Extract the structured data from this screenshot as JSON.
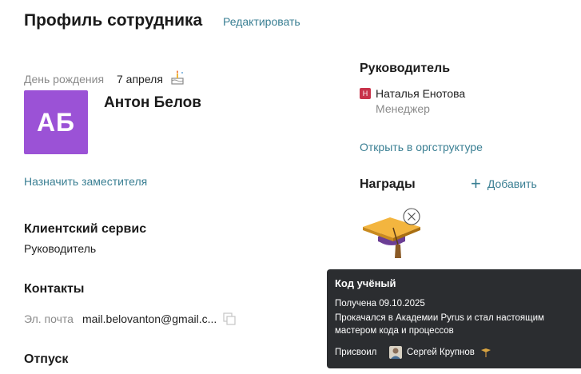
{
  "header": {
    "title": "Профиль сотрудника",
    "edit_label": "Редактировать"
  },
  "profile": {
    "birthday_label": "День рождения",
    "birthday_value": "7 апреля",
    "avatar_initials": "АБ",
    "avatar_color": "#9b52d6",
    "name": "Антон Белов",
    "assign_deputy": "Назначить заместителя",
    "department": "Клиентский сервис",
    "department_role": "Руководитель",
    "contacts_title": "Контакты",
    "email_label": "Эл. почта",
    "email_value": "mail.belovanton@gmail.c...",
    "vacation_title": "Отпуск"
  },
  "manager": {
    "title": "Руководитель",
    "badge_initial": "Н",
    "badge_color": "#c8334b",
    "name": "Наталья Енотова",
    "position": "Менеджер",
    "orgchart_link": "Открыть в оргструктуре"
  },
  "awards": {
    "title": "Награды",
    "add_label": "Добавить",
    "items": [
      {
        "icon": "graduation-cap-award-icon"
      }
    ],
    "tooltip": {
      "title": "Код учёный",
      "received": "Получена 09.10.2025",
      "description": "Прокачался в Академии Pyrus и стал настоящим мастером кода и процессов",
      "assigned_label": "Присвоил",
      "assigned_by": "Сергей Крупнов"
    }
  },
  "colors": {
    "accent": "#3a7f93",
    "tooltip_bg": "#2b2d30"
  }
}
